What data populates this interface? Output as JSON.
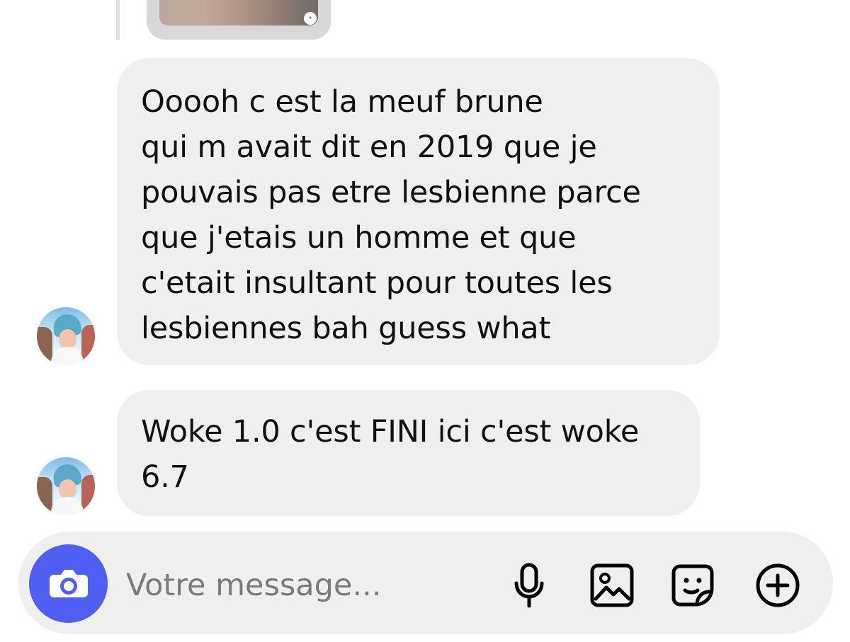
{
  "colors": {
    "background": "#ffffff",
    "bubble": "#efefef",
    "text": "#111111",
    "composer": "#efefef",
    "camera_button": "#4f5ff1",
    "placeholder": "#7a7a7a"
  },
  "messages": [
    {
      "lines": [
        "Ooooh c est la meuf brune",
        "qui m avait dit en 2019 que je",
        "pouvais pas etre lesbienne parce",
        "que j'etais un homme et que",
        "c'etait insultant pour toutes les",
        "lesbiennes bah guess what"
      ]
    },
    {
      "lines": [
        "Woke 1.0 c'est FINI ici c'est woke",
        "6.7"
      ]
    }
  ],
  "composer": {
    "placeholder": "Votre message..."
  },
  "icons": {
    "camera": "camera-icon",
    "microphone": "microphone-icon",
    "gallery": "gallery-icon",
    "sticker": "sticker-icon",
    "add": "plus-circle-icon"
  }
}
